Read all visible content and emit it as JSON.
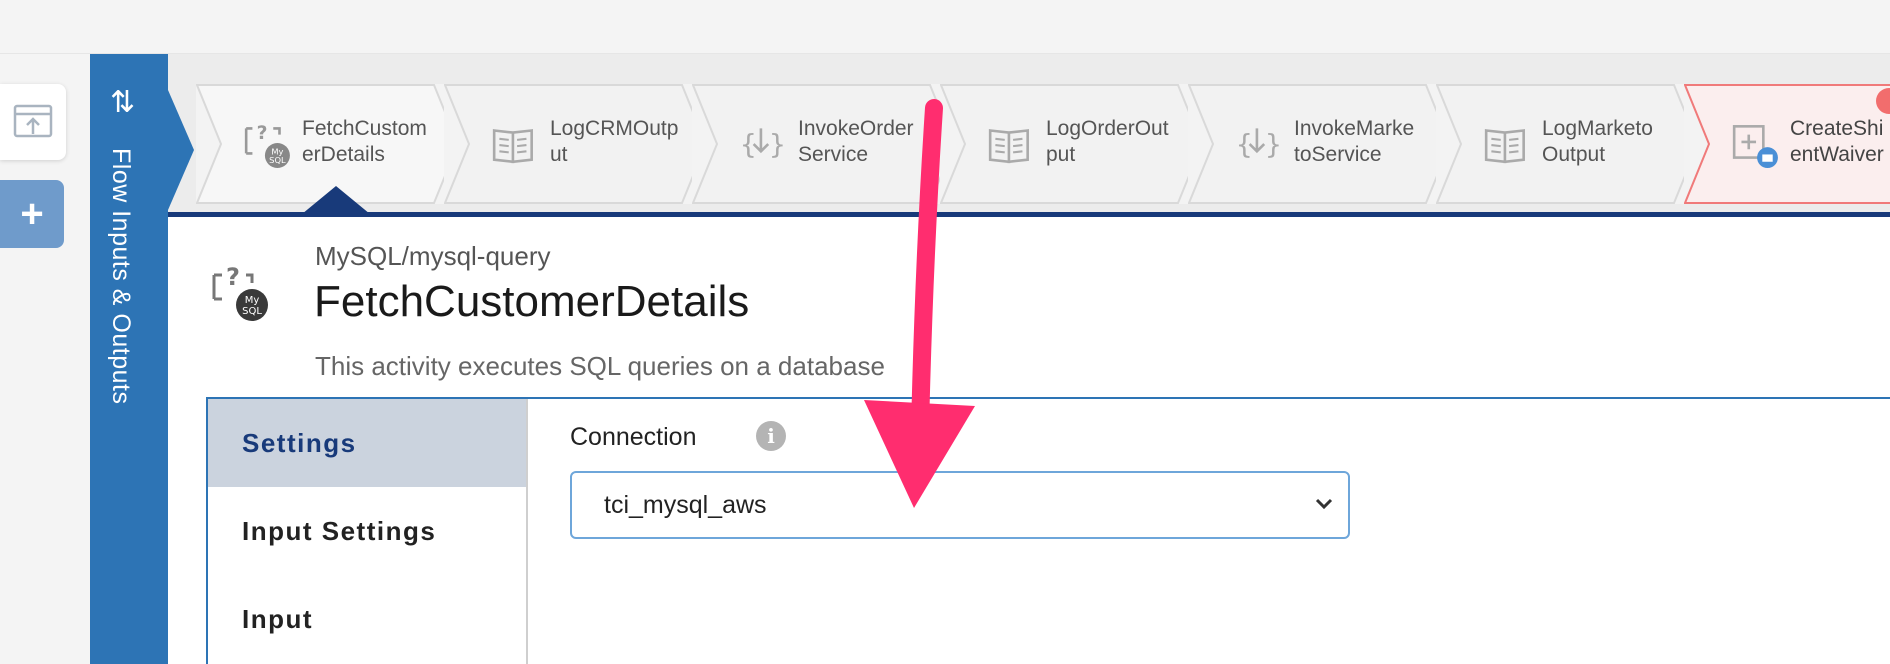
{
  "rail": {
    "label": "Flow Inputs & Outputs",
    "icon": "swap-arrows-icon"
  },
  "left_buttons": {
    "export_icon": "export-window-icon",
    "add_label": "+"
  },
  "steps": [
    {
      "label": "FetchCustom\nerDetails",
      "icon": "mysql-query-icon",
      "active": true
    },
    {
      "label": "LogCRMOutp\nut",
      "icon": "book-log-icon"
    },
    {
      "label": "InvokeOrder\nService",
      "icon": "invoke-service-icon"
    },
    {
      "label": "LogOrderOut\nput",
      "icon": "book-log-icon"
    },
    {
      "label": "InvokeMarke\ntoService",
      "icon": "invoke-service-icon"
    },
    {
      "label": "LogMarketo\nOutput",
      "icon": "book-log-icon"
    },
    {
      "label": "CreateShi\nentWaiver",
      "icon": "create-record-icon",
      "error": true
    }
  ],
  "activity": {
    "type": "MySQL/mysql-query",
    "name": "FetchCustomerDetails",
    "description": "This activity executes SQL queries on a database",
    "icon_text": "My\nSQL"
  },
  "tabs": [
    {
      "label": "Settings",
      "active": true
    },
    {
      "label": "Input Settings"
    },
    {
      "label": "Input"
    }
  ],
  "connection": {
    "label": "Connection",
    "value": "tci_mysql_aws",
    "info_glyph": "i"
  },
  "colors": {
    "rail_blue": "#2d74b5",
    "active_navy": "#183a7a",
    "annotation_pink": "#ff2d6f",
    "error_red": "#f26d6d"
  }
}
